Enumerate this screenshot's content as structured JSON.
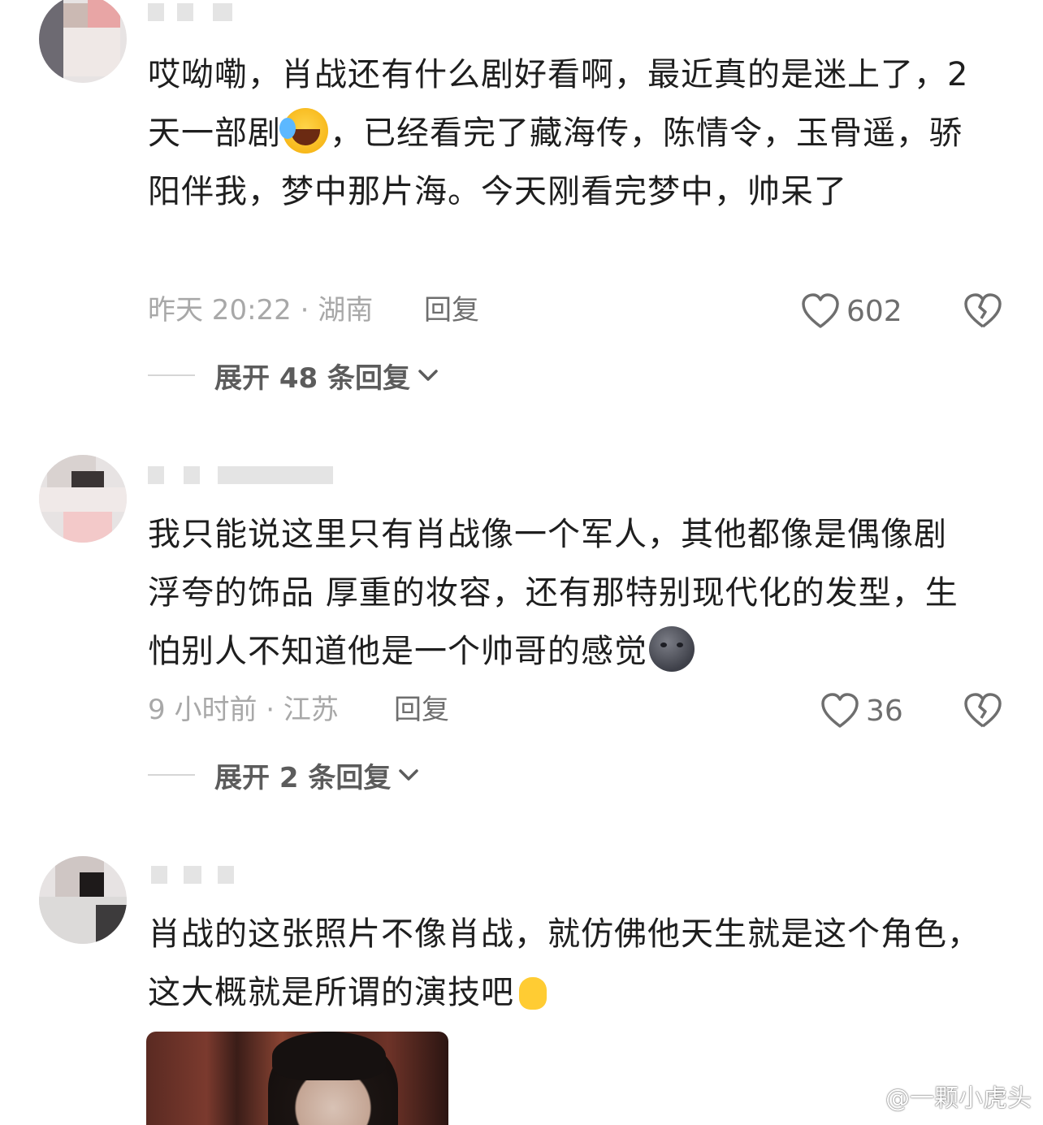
{
  "comments": [
    {
      "text_before_emoji": "哎呦嘞，肖战还有什么剧好看啊，最近真的是迷上了，2天一部剧",
      "emoji_1": "grinning-squinting-tears-emoji",
      "text_after_emoji": "，已经看完了藏海传，陈情令，玉骨遥，骄阳伴我，梦中那片海。今天刚看完梦中，帅呆了",
      "time_location": "昨天 20:22 · 湖南",
      "reply_label": "回复",
      "likes": "602",
      "expand_label": "展开 48 条回复"
    },
    {
      "text_before_emoji": "我只能说这里只有肖战像一个军人，其他都像是偶像剧 浮夸的饰品 厚重的妆容，还有那特别现代化的发型，生怕别人不知道他是一个帅哥的感觉",
      "emoji_1": "new-moon-face-emoji",
      "time_location": "9 小时前 · 江苏",
      "reply_label": "回复",
      "likes": "36",
      "expand_label": "展开 2 条回复"
    },
    {
      "text_before_emoji": "肖战的这张照片不像肖战，就仿佛他天生就是这个角色，这大概就是所谓的演技吧",
      "emoji_1": "finger-heart-emoji"
    }
  ],
  "watermark": "@一颗小虎头",
  "colors": {
    "muted": "#a8a8a8",
    "text": "#1e1e1e",
    "accent_heart": "#f0386b"
  }
}
